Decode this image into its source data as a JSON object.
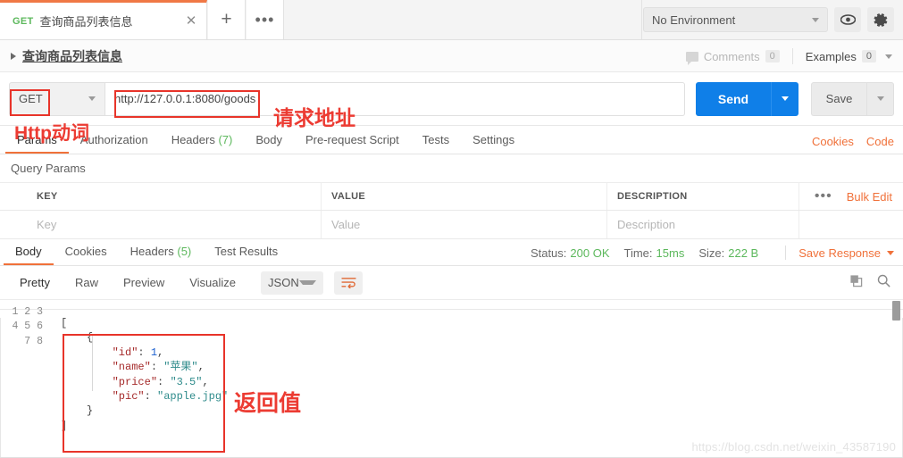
{
  "tab": {
    "method": "GET",
    "title": "查询商品列表信息",
    "close_label": "✕",
    "plus_label": "+",
    "more_label": "•••"
  },
  "topbar": {
    "environment": "No Environment",
    "eye_icon": "eye-icon",
    "gear_icon": "gear-icon"
  },
  "request_header": {
    "title": "查询商品列表信息",
    "comments_label": "Comments",
    "comments_count": "0",
    "examples_label": "Examples",
    "examples_count": "0"
  },
  "urlbar": {
    "method": "GET",
    "url": "http://127.0.0.1:8080/goods",
    "send_label": "Send",
    "save_label": "Save"
  },
  "request_tabs": {
    "items": [
      {
        "label": "Params",
        "count": "",
        "active": true
      },
      {
        "label": "Authorization",
        "count": "",
        "active": false
      },
      {
        "label": "Headers",
        "count": "(7)",
        "active": false
      },
      {
        "label": "Body",
        "count": "",
        "active": false
      },
      {
        "label": "Pre-request Script",
        "count": "",
        "active": false
      },
      {
        "label": "Tests",
        "count": "",
        "active": false
      },
      {
        "label": "Settings",
        "count": "",
        "active": false
      }
    ],
    "cookies_link": "Cookies",
    "code_link": "Code"
  },
  "query_params": {
    "section_label": "Query Params",
    "headers": [
      "KEY",
      "VALUE",
      "DESCRIPTION"
    ],
    "bulk_edit_label": "Bulk Edit",
    "more_label": "•••",
    "placeholder_row": {
      "key": "Key",
      "value": "Value",
      "description": "Description"
    }
  },
  "response": {
    "tabs": [
      {
        "label": "Body",
        "count": "",
        "active": true
      },
      {
        "label": "Cookies",
        "count": "",
        "active": false
      },
      {
        "label": "Headers",
        "count": "(5)",
        "active": false
      },
      {
        "label": "Test Results",
        "count": "",
        "active": false
      }
    ],
    "status_label": "Status:",
    "status_value": "200 OK",
    "time_label": "Time:",
    "time_value": "15ms",
    "size_label": "Size:",
    "size_value": "222 B",
    "save_response_label": "Save Response",
    "view_tabs": [
      {
        "label": "Pretty",
        "active": true
      },
      {
        "label": "Raw",
        "active": false
      },
      {
        "label": "Preview",
        "active": false
      },
      {
        "label": "Visualize",
        "active": false
      }
    ],
    "format": "JSON",
    "wrap_icon": "wrap-lines-icon",
    "copy_icon": "copy-icon",
    "search_icon": "search-icon",
    "line_numbers": "1\n2\n3\n4\n5\n6\n7\n8",
    "body_json": "[\n    {\n        \"id\": 1,\n        \"name\": \"苹果\",\n        \"price\": \"3.5\",\n        \"pic\": \"apple.jpg\"\n    }\n]"
  },
  "annotations": [
    {
      "id": "http-verb",
      "text": "Http动词"
    },
    {
      "id": "request-url",
      "text": "请求地址"
    },
    {
      "id": "return-value",
      "text": "返回值"
    }
  ],
  "watermark": "https://blog.csdn.net/weixin_43587190",
  "colors": {
    "accent_orange": "#f0713a",
    "send_blue": "#0f7fe8",
    "status_green": "#5cb85c",
    "annotation_red": "#ec3b32"
  }
}
